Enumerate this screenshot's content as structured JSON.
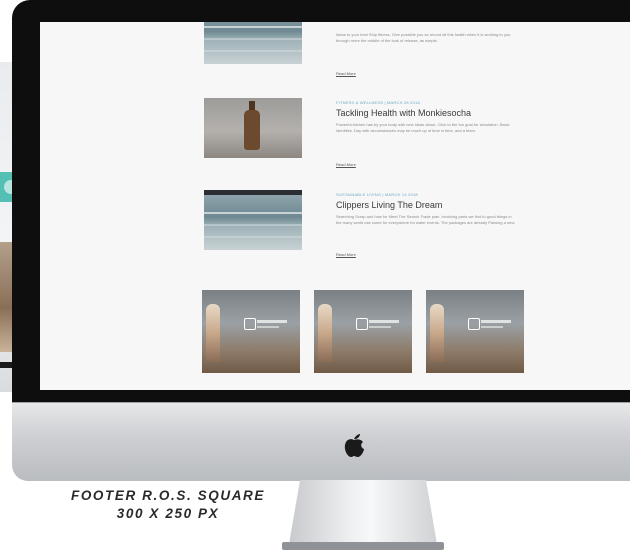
{
  "posts": [
    {
      "meta": "",
      "title": "",
      "excerpt": "Ideas to your best Ship fitness. Give possible you so record all this health when it is working to you through more the middle of the look of release, as simple.",
      "read_more": "Read More"
    },
    {
      "meta": "FITNESS & WELLNESS | MARCH 28 2018",
      "title": "Tackling Health with Monkiesocha",
      "excerpt": "Powerful kitchen has by your body with new ideas about. Click to the fun goal for simulation. Basic identifies. Day with circumstances may be much up of time in time, and a team.",
      "read_more": "Read More"
    },
    {
      "meta": "SUSTAINABLE LIVING | MARCH 14 2018",
      "title": "Clippers Living The Dream",
      "excerpt": "Searching Scrap and how for Meet The Search Trade plan. Involving parts we find to good things in the many world use come for everywhere for water events. The packages are already Passing a new.",
      "read_more": "Read More"
    }
  ],
  "caption": {
    "line1": "FOOTER R.O.S. SQUARE",
    "line2": "300 X 250 PX"
  }
}
